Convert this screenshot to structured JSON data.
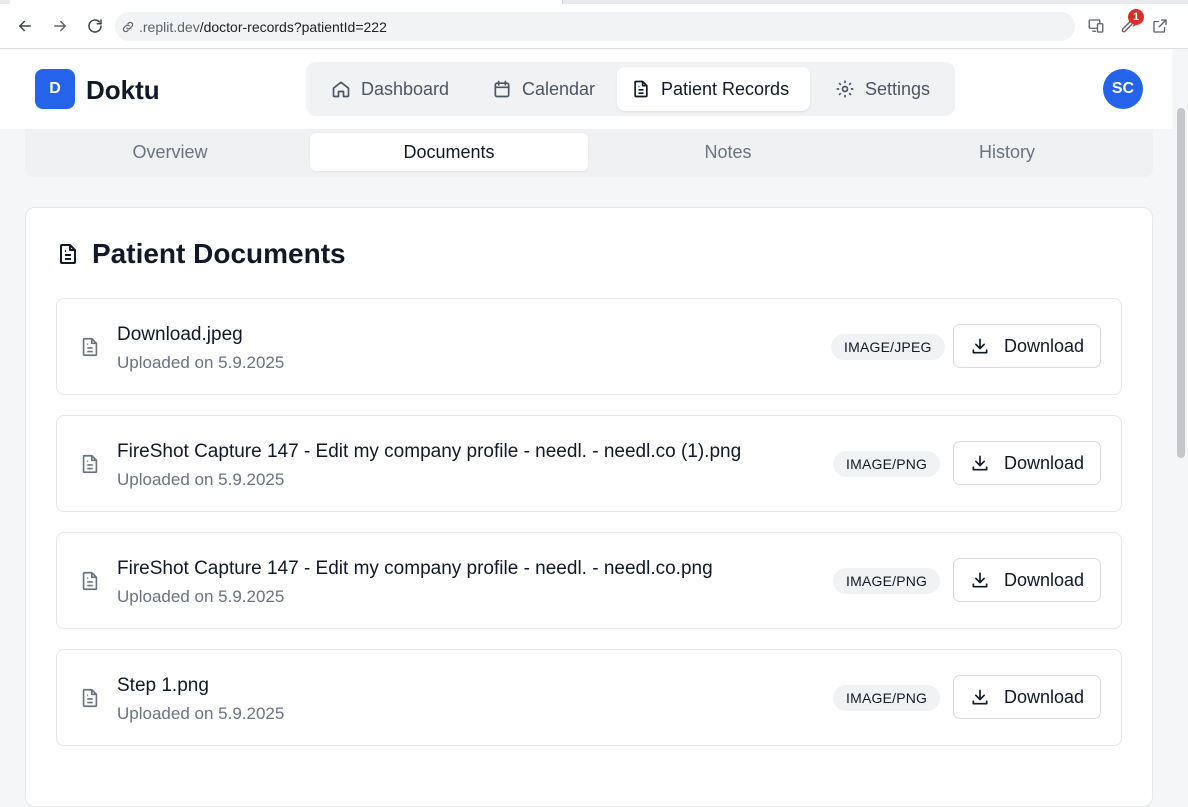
{
  "browser": {
    "url_host": ".replit.dev",
    "url_path": "/doctor-records?patientId=222",
    "extensions_badge": "1"
  },
  "app": {
    "logo_letter": "D",
    "brand": "Doktu",
    "avatar_initials": "SC",
    "nav": [
      {
        "label": "Dashboard",
        "icon": "home-icon"
      },
      {
        "label": "Calendar",
        "icon": "calendar-icon"
      },
      {
        "label": "Patient Records",
        "icon": "file-text-icon",
        "active": true
      },
      {
        "label": "Settings",
        "icon": "gear-icon"
      }
    ]
  },
  "subtabs": [
    {
      "label": "Overview"
    },
    {
      "label": "Documents",
      "active": true
    },
    {
      "label": "Notes"
    },
    {
      "label": "History"
    }
  ],
  "documents_card": {
    "title": "Patient Documents",
    "download_label": "Download",
    "items": [
      {
        "name": "Download.jpeg",
        "uploaded": "Uploaded on 5.9.2025",
        "type": "IMAGE/JPEG"
      },
      {
        "name": "FireShot Capture 147 - Edit my company profile - needl. - needl.co (1).png",
        "uploaded": "Uploaded on 5.9.2025",
        "type": "IMAGE/PNG"
      },
      {
        "name": "FireShot Capture 147 - Edit my company profile - needl. - needl.co.png",
        "uploaded": "Uploaded on 5.9.2025",
        "type": "IMAGE/PNG"
      },
      {
        "name": "Step 1.png",
        "uploaded": "Uploaded on 5.9.2025",
        "type": "IMAGE/PNG"
      }
    ]
  },
  "colors": {
    "accent": "#2563eb",
    "badge_red": "#d93025"
  }
}
